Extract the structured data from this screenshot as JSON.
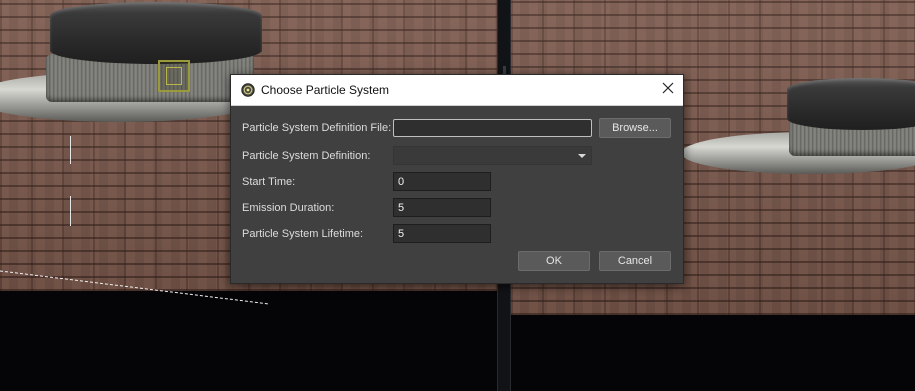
{
  "dialog": {
    "title": "Choose Particle System",
    "icon": "particle-system-icon",
    "close_icon": "close-icon",
    "fields": {
      "definition_file": {
        "label": "Particle System Definition File:",
        "value": "",
        "placeholder": ""
      },
      "definition": {
        "label": "Particle System Definition:",
        "value": ""
      },
      "start_time": {
        "label": "Start Time:",
        "value": "0"
      },
      "emission_duration": {
        "label": "Emission Duration:",
        "value": "5"
      },
      "lifetime": {
        "label": "Particle System Lifetime:",
        "value": "5"
      }
    },
    "browse_label": "Browse...",
    "ok_label": "OK",
    "cancel_label": "Cancel"
  },
  "colors": {
    "dialog_bg": "#404040",
    "titlebar_bg": "#ffffff",
    "input_bg": "#2f2f2f",
    "button_bg": "#5a5a5a",
    "viewport_bg": "#050507",
    "wall": "#7b5a4e",
    "gizmo_yellow": "#9b9a3a"
  }
}
